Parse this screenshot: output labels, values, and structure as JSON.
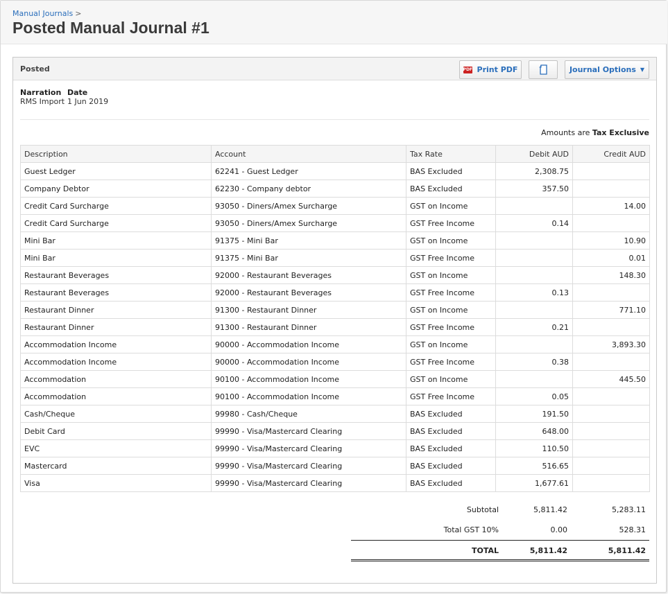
{
  "breadcrumb": {
    "link": "Manual Journals",
    "separator": ">"
  },
  "page": {
    "title": "Posted Manual Journal #1"
  },
  "panel": {
    "status": "Posted",
    "buttons": {
      "print_pdf": "Print PDF",
      "pdf_icon_text": "PDF",
      "journal_options": "Journal Options"
    }
  },
  "meta": {
    "narration_label": "Narration",
    "date_label": "Date",
    "narration_value": "RMS Import",
    "date_value": "1 Jun 2019"
  },
  "amounts_note": {
    "prefix": "Amounts are",
    "mode": "Tax Exclusive"
  },
  "table": {
    "headers": [
      "Description",
      "Account",
      "Tax Rate",
      "Debit AUD",
      "Credit AUD"
    ],
    "rows": [
      [
        "Guest Ledger",
        "62241 - Guest Ledger",
        "BAS Excluded",
        "2,308.75",
        ""
      ],
      [
        "Company Debtor",
        "62230 - Company debtor",
        "BAS Excluded",
        "357.50",
        ""
      ],
      [
        "Credit Card Surcharge",
        "93050 - Diners/Amex Surcharge",
        "GST on Income",
        "",
        "14.00"
      ],
      [
        "Credit Card Surcharge",
        "93050 - Diners/Amex Surcharge",
        "GST Free Income",
        "0.14",
        ""
      ],
      [
        "Mini Bar",
        "91375 - Mini Bar",
        "GST on Income",
        "",
        "10.90"
      ],
      [
        "Mini Bar",
        "91375 - Mini Bar",
        "GST Free Income",
        "",
        "0.01"
      ],
      [
        "Restaurant Beverages",
        "92000 - Restaurant Beverages",
        "GST on Income",
        "",
        "148.30"
      ],
      [
        "Restaurant Beverages",
        "92000 - Restaurant Beverages",
        "GST Free Income",
        "0.13",
        ""
      ],
      [
        "Restaurant Dinner",
        "91300 - Restaurant Dinner",
        "GST on Income",
        "",
        "771.10"
      ],
      [
        "Restaurant Dinner",
        "91300 - Restaurant Dinner",
        "GST Free Income",
        "0.21",
        ""
      ],
      [
        "Accommodation Income",
        "90000 - Accommodation Income",
        "GST on Income",
        "",
        "3,893.30"
      ],
      [
        "Accommodation Income",
        "90000 - Accommodation Income",
        "GST Free Income",
        "0.38",
        ""
      ],
      [
        "Accommodation",
        "90100 - Accommodation Income",
        "GST on Income",
        "",
        "445.50"
      ],
      [
        "Accommodation",
        "90100 - Accommodation Income",
        "GST Free Income",
        "0.05",
        ""
      ],
      [
        "Cash/Cheque",
        "99980 - Cash/Cheque",
        "BAS Excluded",
        "191.50",
        ""
      ],
      [
        "Debit Card",
        "99990 - Visa/Mastercard Clearing",
        "BAS Excluded",
        "648.00",
        ""
      ],
      [
        "EVC",
        "99990 - Visa/Mastercard Clearing",
        "BAS Excluded",
        "110.50",
        ""
      ],
      [
        "Mastercard",
        "99990 - Visa/Mastercard Clearing",
        "BAS Excluded",
        "516.65",
        ""
      ],
      [
        "Visa",
        "99990 - Visa/Mastercard Clearing",
        "BAS Excluded",
        "1,677.61",
        ""
      ]
    ]
  },
  "totals": [
    {
      "label": "Subtotal",
      "debit": "5,811.42",
      "credit": "5,283.11"
    },
    {
      "label": "Total GST 10%",
      "debit": "0.00",
      "credit": "528.31"
    },
    {
      "label": "TOTAL",
      "debit": "5,811.42",
      "credit": "5,811.42"
    }
  ],
  "colors": {
    "link": "#2a6ebb",
    "pdf_icon": "#cc2222"
  }
}
